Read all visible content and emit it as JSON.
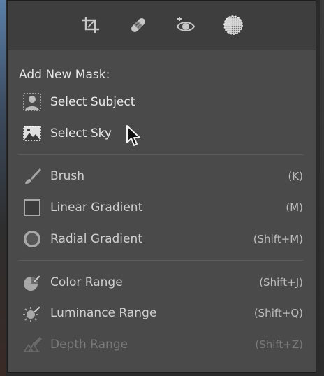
{
  "toolbar": {
    "tools": [
      {
        "icon": "crop-icon"
      },
      {
        "icon": "healing-bandage-icon"
      },
      {
        "icon": "red-eye-icon"
      },
      {
        "icon": "masking-icon",
        "active": true
      }
    ]
  },
  "menu": {
    "title": "Add New Mask:",
    "items": [
      {
        "label": "Select Subject",
        "shortcut": "",
        "icon": "person-silhouette-icon"
      },
      {
        "label": "Select Sky",
        "shortcut": "",
        "icon": "sky-landscape-icon"
      },
      {
        "label": "Brush",
        "shortcut": "(K)",
        "icon": "brush-icon"
      },
      {
        "label": "Linear Gradient",
        "shortcut": "(M)",
        "icon": "linear-gradient-icon"
      },
      {
        "label": "Radial Gradient",
        "shortcut": "(Shift+M)",
        "icon": "radial-gradient-icon"
      },
      {
        "label": "Color Range",
        "shortcut": "(Shift+J)",
        "icon": "color-range-icon"
      },
      {
        "label": "Luminance Range",
        "shortcut": "(Shift+Q)",
        "icon": "luminance-range-icon"
      },
      {
        "label": "Depth Range",
        "shortcut": "(Shift+Z)",
        "icon": "depth-range-icon",
        "disabled": true
      }
    ]
  }
}
